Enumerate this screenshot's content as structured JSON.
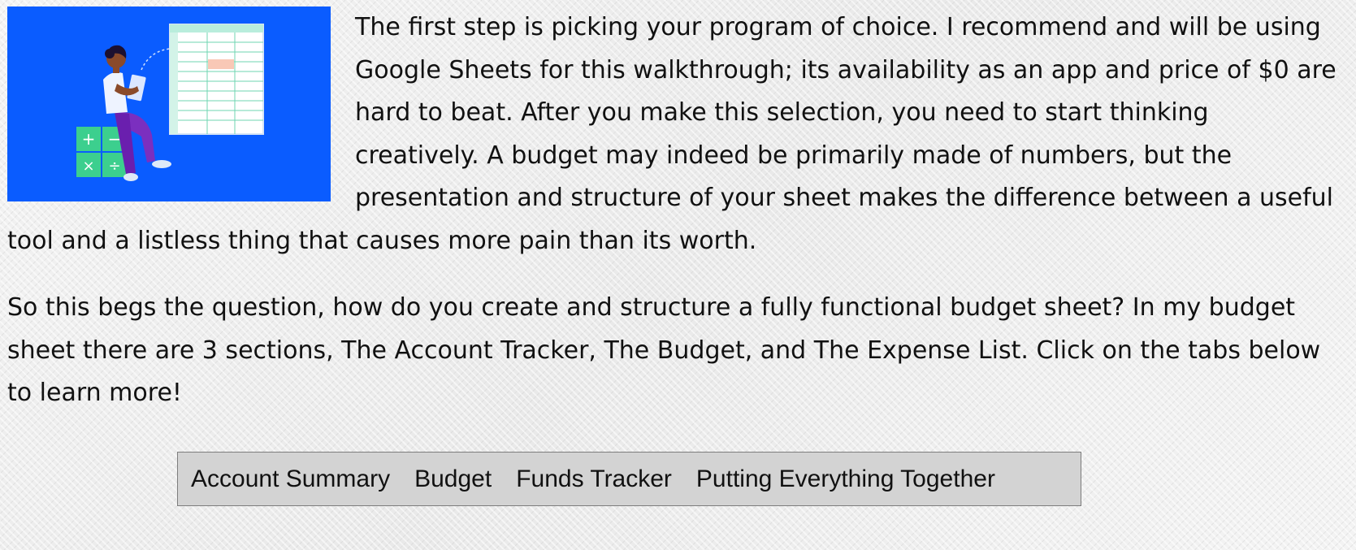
{
  "article": {
    "paragraph1": "The first step is picking your program of choice. I recommend and will be using Google Sheets for this walkthrough; its availability as an app and price of $0 are hard to beat. After you make this selection, you need to start thinking creatively. A budget may indeed be primarily made of numbers, but the presentation and structure of your sheet makes the difference between a useful tool and a listless thing that causes more pain than its worth.",
    "paragraph2": "So this begs the question, how do you create and structure a fully functional budget sheet? In my budget sheet there are 3 sections, The Account Tracker, The Budget, and The Expense List. Click on the tabs below to learn more!"
  },
  "illustration": {
    "icon": "spreadsheet-illustration",
    "background_color": "#0a5cff",
    "calculator_symbols": [
      "+",
      "−",
      "×",
      "÷"
    ]
  },
  "tabs": [
    {
      "label": "Account Summary"
    },
    {
      "label": "Budget"
    },
    {
      "label": "Funds Tracker"
    },
    {
      "label": "Putting Everything Together"
    }
  ]
}
